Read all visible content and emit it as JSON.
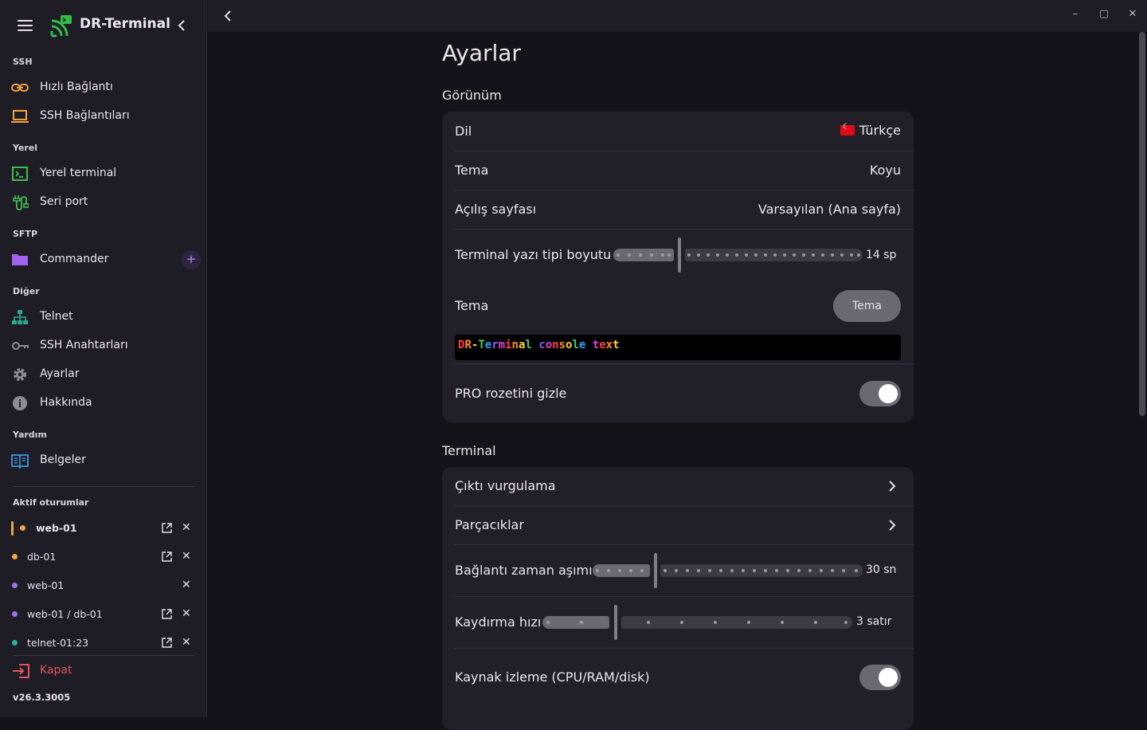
{
  "app": {
    "title": "DR-Terminal",
    "version": "v26.3.3005"
  },
  "sidebar": {
    "sections": {
      "ssh": "SSH",
      "local": "Yerel",
      "sftp": "SFTP",
      "other": "Diğer",
      "help": "Yardım",
      "active_sessions": "Aktif oturumlar"
    },
    "items": {
      "quick_connect": "Hızlı Bağlantı",
      "ssh_connections": "SSH Bağlantıları",
      "local_terminal": "Yerel terminal",
      "serial_port": "Seri port",
      "commander": "Commander",
      "telnet": "Telnet",
      "ssh_keys": "SSH Anahtarları",
      "settings": "Ayarlar",
      "about": "Hakkında",
      "docs": "Belgeler"
    },
    "sessions": [
      {
        "name": "web-01",
        "color": "#f5a340",
        "active": true
      },
      {
        "name": "db-01",
        "color": "#f5a340"
      },
      {
        "name": "web-01",
        "color": "#a66cf0"
      },
      {
        "name": "web-01 / db-01",
        "color": "#a66cf0"
      },
      {
        "name": "telnet-01:23",
        "color": "#2ab0a0"
      }
    ],
    "close_label": "Kapat"
  },
  "window_controls": {
    "minimize": "–",
    "maximize": "▢",
    "close": "✕"
  },
  "page": {
    "title": "Ayarlar",
    "appearance": {
      "heading": "Görünüm",
      "language_label": "Dil",
      "language_value": "Türkçe",
      "theme_label": "Tema",
      "theme_value": "Koyu",
      "start_page_label": "Açılış sayfası",
      "start_page_value": "Varsayılan (Ana sayfa)",
      "font_size_label": "Terminal yazı tipi boyutu",
      "font_size_value": "14 sp",
      "terminal_theme_label": "Tema",
      "terminal_theme_button": "Tema",
      "console_preview": [
        "D",
        "R",
        "-",
        "T",
        "e",
        "r",
        "m",
        "i",
        "n",
        "a",
        "l",
        " ",
        "c",
        "o",
        "n",
        "s",
        "o",
        "l",
        "e",
        " ",
        "t",
        "e",
        "x",
        "t"
      ],
      "hide_pro_label": "PRO rozetini gizle"
    },
    "terminal": {
      "heading": "Terminal",
      "output_highlight": "Çıktı vurgulama",
      "snippets": "Parçacıklar",
      "timeout_label": "Bağlantı zaman aşımı",
      "timeout_value": "30 sn",
      "scroll_label": "Kaydırma hızı",
      "scroll_value": "3 satır",
      "resource_monitor": "Kaynak izleme (CPU/RAM/disk)"
    }
  },
  "colors": {
    "accent": "#6a6870",
    "rainbow": [
      "#ff4040",
      "#ff8a30",
      "#ffd030",
      "#40d060",
      "#30a0ff",
      "#8060ff",
      "#e040e0"
    ]
  }
}
